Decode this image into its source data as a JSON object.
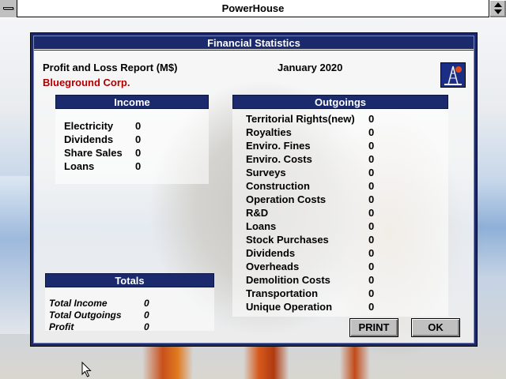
{
  "window": {
    "title": "PowerHouse"
  },
  "dialog": {
    "title": "Financial Statistics",
    "report_title": "Profit and Loss Report (M$)",
    "date": "January 2020",
    "company": "Blueground Corp.",
    "company_color": "#b00000",
    "accent_color": "#1a2a6c"
  },
  "income": {
    "header": "Income",
    "rows": [
      {
        "label": "Electricity",
        "value": "0"
      },
      {
        "label": "Dividends",
        "value": "0"
      },
      {
        "label": "Share Sales",
        "value": "0"
      },
      {
        "label": "Loans",
        "value": "0"
      }
    ]
  },
  "outgoings": {
    "header": "Outgoings",
    "rows": [
      {
        "label": "Territorial Rights(new)",
        "value": "0"
      },
      {
        "label": "Royalties",
        "value": "0"
      },
      {
        "label": "Enviro. Fines",
        "value": "0"
      },
      {
        "label": "Enviro. Costs",
        "value": "0"
      },
      {
        "label": "Surveys",
        "value": "0"
      },
      {
        "label": "Construction",
        "value": "0"
      },
      {
        "label": "Operation Costs",
        "value": "0"
      },
      {
        "label": "R&D",
        "value": "0"
      },
      {
        "label": "Loans",
        "value": "0"
      },
      {
        "label": "Stock Purchases",
        "value": "0"
      },
      {
        "label": "Dividends",
        "value": "0"
      },
      {
        "label": "Overheads",
        "value": "0"
      },
      {
        "label": "Demolition Costs",
        "value": "0"
      },
      {
        "label": "Transportation",
        "value": "0"
      },
      {
        "label": "Unique Operation",
        "value": "0"
      }
    ]
  },
  "totals": {
    "header": "Totals",
    "rows": [
      {
        "label": "Total Income",
        "value": "0"
      },
      {
        "label": "Total Outgoings",
        "value": "0"
      },
      {
        "label": "Profit",
        "value": "0"
      }
    ]
  },
  "buttons": {
    "print_label": "PRINT",
    "ok_label": "OK"
  },
  "icons": {
    "logo": "oil-rig-icon",
    "system_menu": "system-menu-icon",
    "restore": "restore-icon",
    "cursor": "mouse-pointer-icon"
  }
}
